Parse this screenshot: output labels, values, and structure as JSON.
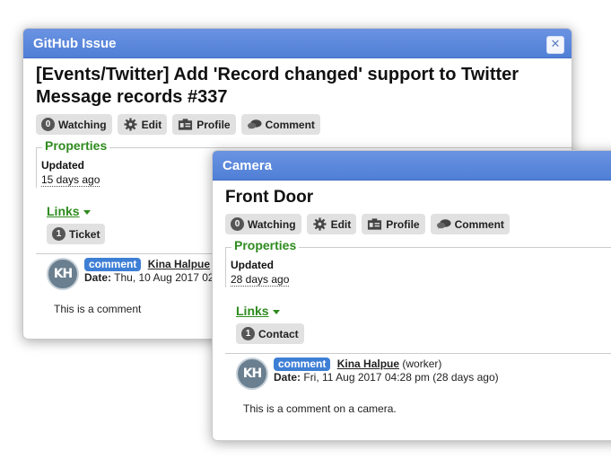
{
  "issue_window": {
    "title": "GitHub Issue",
    "heading": "[Events/Twitter] Add 'Record changed' support to Twitter Message records #337",
    "toolbar": {
      "watching_count": "0",
      "watching_label": "Watching",
      "edit_label": "Edit",
      "profile_label": "Profile",
      "comment_label": "Comment"
    },
    "properties": {
      "legend": "Properties",
      "updated_label": "Updated",
      "updated_value": "15 days ago"
    },
    "links_label": "Links",
    "link_button": {
      "count": "1",
      "label": "Ticket"
    },
    "comment": {
      "avatar": "KH",
      "tag": "comment",
      "author": "Kina Halpue",
      "author_suffix": "(",
      "date_label": "Date:",
      "date_value": "Thu, 10 Aug 2017 02",
      "text": "This is a comment"
    }
  },
  "camera_window": {
    "title": "Camera",
    "heading": "Front Door",
    "toolbar": {
      "watching_count": "0",
      "watching_label": "Watching",
      "edit_label": "Edit",
      "profile_label": "Profile",
      "comment_label": "Comment"
    },
    "properties": {
      "legend": "Properties",
      "updated_label": "Updated",
      "updated_value": "28 days ago"
    },
    "links_label": "Links",
    "link_button": {
      "count": "1",
      "label": "Contact"
    },
    "comment": {
      "avatar": "KH",
      "tag": "comment",
      "author": "Kina Halpue",
      "author_role": "(worker)",
      "date_label": "Date:",
      "date_value": "Fri, 11 Aug 2017 04:28 pm (28 days ago)",
      "text": "This is a comment on a camera."
    }
  },
  "colors": {
    "titlebar": "#5a85d9",
    "accent_green": "#2e8b1e",
    "tag_blue": "#3e7fd6",
    "button_gray": "#e1e1e1"
  },
  "icons": [
    "close-icon",
    "gear-icon",
    "profile-card-icon",
    "comment-bubble-icon"
  ]
}
